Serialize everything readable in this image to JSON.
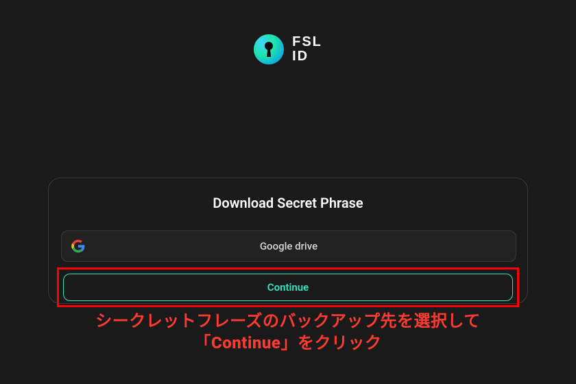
{
  "logo": {
    "line1": "FSL",
    "line2": "ID"
  },
  "card": {
    "title": "Download Secret Phrase",
    "option": {
      "label": "Google drive",
      "icon": "google-icon"
    },
    "continue_label": "Continue"
  },
  "annotation": {
    "line1": "シークレットフレーズのバックアップ先を選択して",
    "line2": "「Continue」をクリック"
  }
}
